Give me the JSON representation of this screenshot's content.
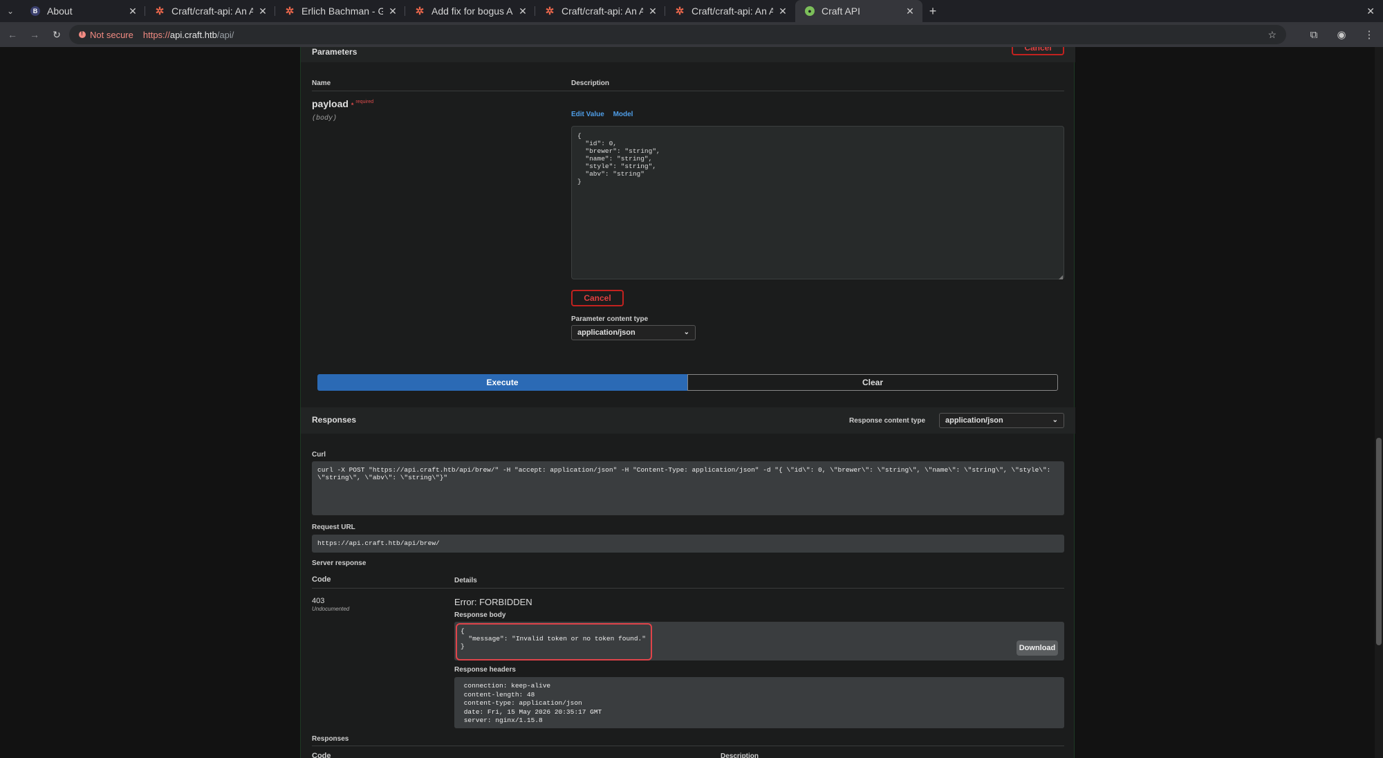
{
  "browser": {
    "tabs": [
      {
        "title": "About",
        "icon": "b-icon"
      },
      {
        "title": "Craft/craft-api: An API f",
        "icon": "gogs-icon"
      },
      {
        "title": "Erlich Bachman - Gogs",
        "icon": "gogs-icon"
      },
      {
        "title": "Add fix for bogus ABV v",
        "icon": "gogs-icon"
      },
      {
        "title": "Craft/craft-api: An API f",
        "icon": "gogs-icon"
      },
      {
        "title": "Craft/craft-api: An API f",
        "icon": "gogs-icon"
      },
      {
        "title": "Craft API",
        "icon": "swagger-icon"
      }
    ],
    "security_label": "Not secure",
    "url_scheme": "https://",
    "url_host": "api.craft.htb",
    "url_path": "/api/"
  },
  "params": {
    "section_title": "Parameters",
    "top_cancel_label": "Cancel",
    "col_name": "Name",
    "col_description": "Description",
    "param_name": "payload",
    "required_star": "*",
    "required_label": "required",
    "param_in": "(body)",
    "edit_value_tab": "Edit Value",
    "model_tab": "Model",
    "body_value": "{\n  \"id\": 0,\n  \"brewer\": \"string\",\n  \"name\": \"string\",\n  \"style\": \"string\",\n  \"abv\": \"string\"\n}",
    "cancel_label": "Cancel",
    "content_type_label": "Parameter content type",
    "content_type_value": "application/json"
  },
  "actions": {
    "execute_label": "Execute",
    "clear_label": "Clear"
  },
  "responses": {
    "title": "Responses",
    "content_type_label": "Response content type",
    "content_type_value": "application/json",
    "curl_label": "Curl",
    "curl_value": "curl -X POST \"https://api.craft.htb/api/brew/\" -H \"accept: application/json\" -H \"Content-Type: application/json\" -d \"{ \\\"id\\\": 0, \\\"brewer\\\": \\\"string\\\", \\\"name\\\": \\\"string\\\", \\\"style\\\":\n\\\"string\\\", \\\"abv\\\": \\\"string\\\"}\"",
    "request_url_label": "Request URL",
    "request_url_value": "https://api.craft.htb/api/brew/",
    "server_response_label": "Server response",
    "col_code": "Code",
    "col_details": "Details",
    "code": "403",
    "code_note": "Undocumented",
    "error_text": "Error: FORBIDDEN",
    "body_label": "Response body",
    "body_value": "{\n  \"message\": \"Invalid token or no token found.\"\n}",
    "download_label": "Download",
    "headers_label": "Response headers",
    "headers_value": " connection: keep-alive\n content-length: 48\n content-type: application/json\n date: Fri, 15 May 2026 20:35:17 GMT\n server: nginx/1.15.8",
    "bottom_title": "Responses",
    "bottom_col_code": "Code",
    "bottom_col_description": "Description"
  }
}
